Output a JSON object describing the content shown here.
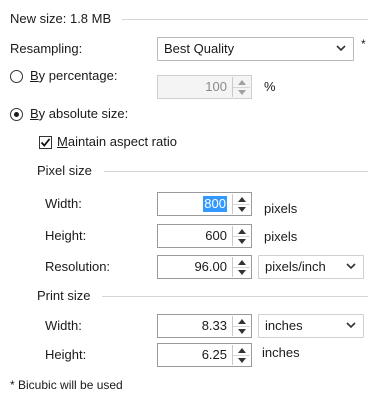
{
  "new_size_label": "New size: 1.8 MB",
  "resampling": {
    "label": "Resampling:",
    "value": "Best Quality",
    "asterisk": "*"
  },
  "by_percentage": {
    "label_u": "B",
    "label_rest": "y percentage:",
    "selected": false,
    "value": "100",
    "unit": "%"
  },
  "by_absolute": {
    "label_u": "B",
    "label_rest": "y absolute size:",
    "selected": true
  },
  "maintain_aspect": {
    "label_u": "M",
    "label_rest": "aintain aspect ratio",
    "checked": true
  },
  "pixel_size": {
    "section_label": "Pixel size",
    "width_label": "Width:",
    "width_value": "800",
    "width_unit": "pixels",
    "height_label": "Height:",
    "height_value": "600",
    "height_unit": "pixels",
    "resolution_label": "Resolution:",
    "resolution_value": "96.00",
    "resolution_unit": "pixels/inch"
  },
  "print_size": {
    "section_label": "Print size",
    "width_label": "Width:",
    "width_value": "8.33",
    "width_unit": "inches",
    "height_label": "Height:",
    "height_value": "6.25",
    "height_unit": "inches"
  },
  "footnote": "* Bicubic will be used",
  "icons": {
    "dropdown": "chevron-down-icon",
    "spin_up": "triangle-up-icon",
    "spin_down": "triangle-down-icon",
    "check": "checkmark-icon"
  },
  "colors": {
    "selection": "#3399ff",
    "separator": "#d6d6d6",
    "border": "#9a9a9a"
  }
}
